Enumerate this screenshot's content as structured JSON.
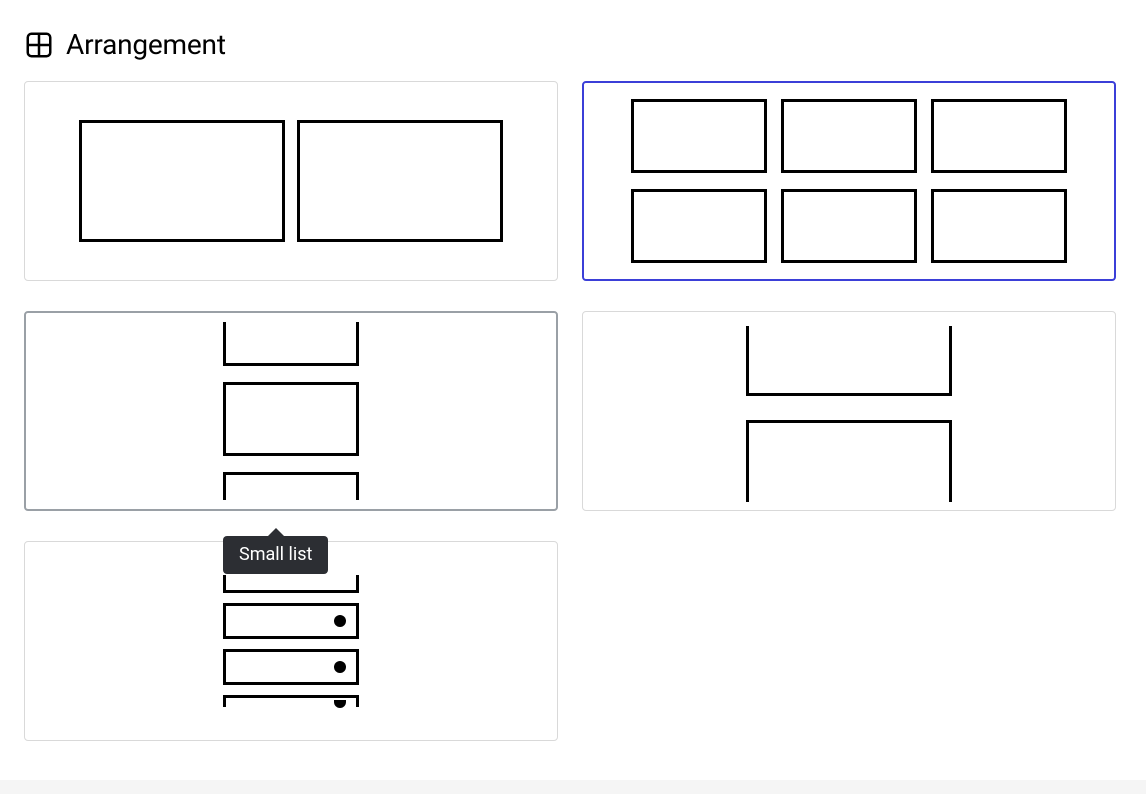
{
  "section": {
    "title": "Arrangement"
  },
  "options": {
    "large_grid": {
      "name": "large-grid"
    },
    "small_grid": {
      "name": "small-grid",
      "selected": true
    },
    "small_list": {
      "name": "small-list",
      "hovered": true,
      "tooltip": "Small list"
    },
    "large_list": {
      "name": "large-list"
    },
    "detail_list": {
      "name": "detail-list"
    }
  }
}
